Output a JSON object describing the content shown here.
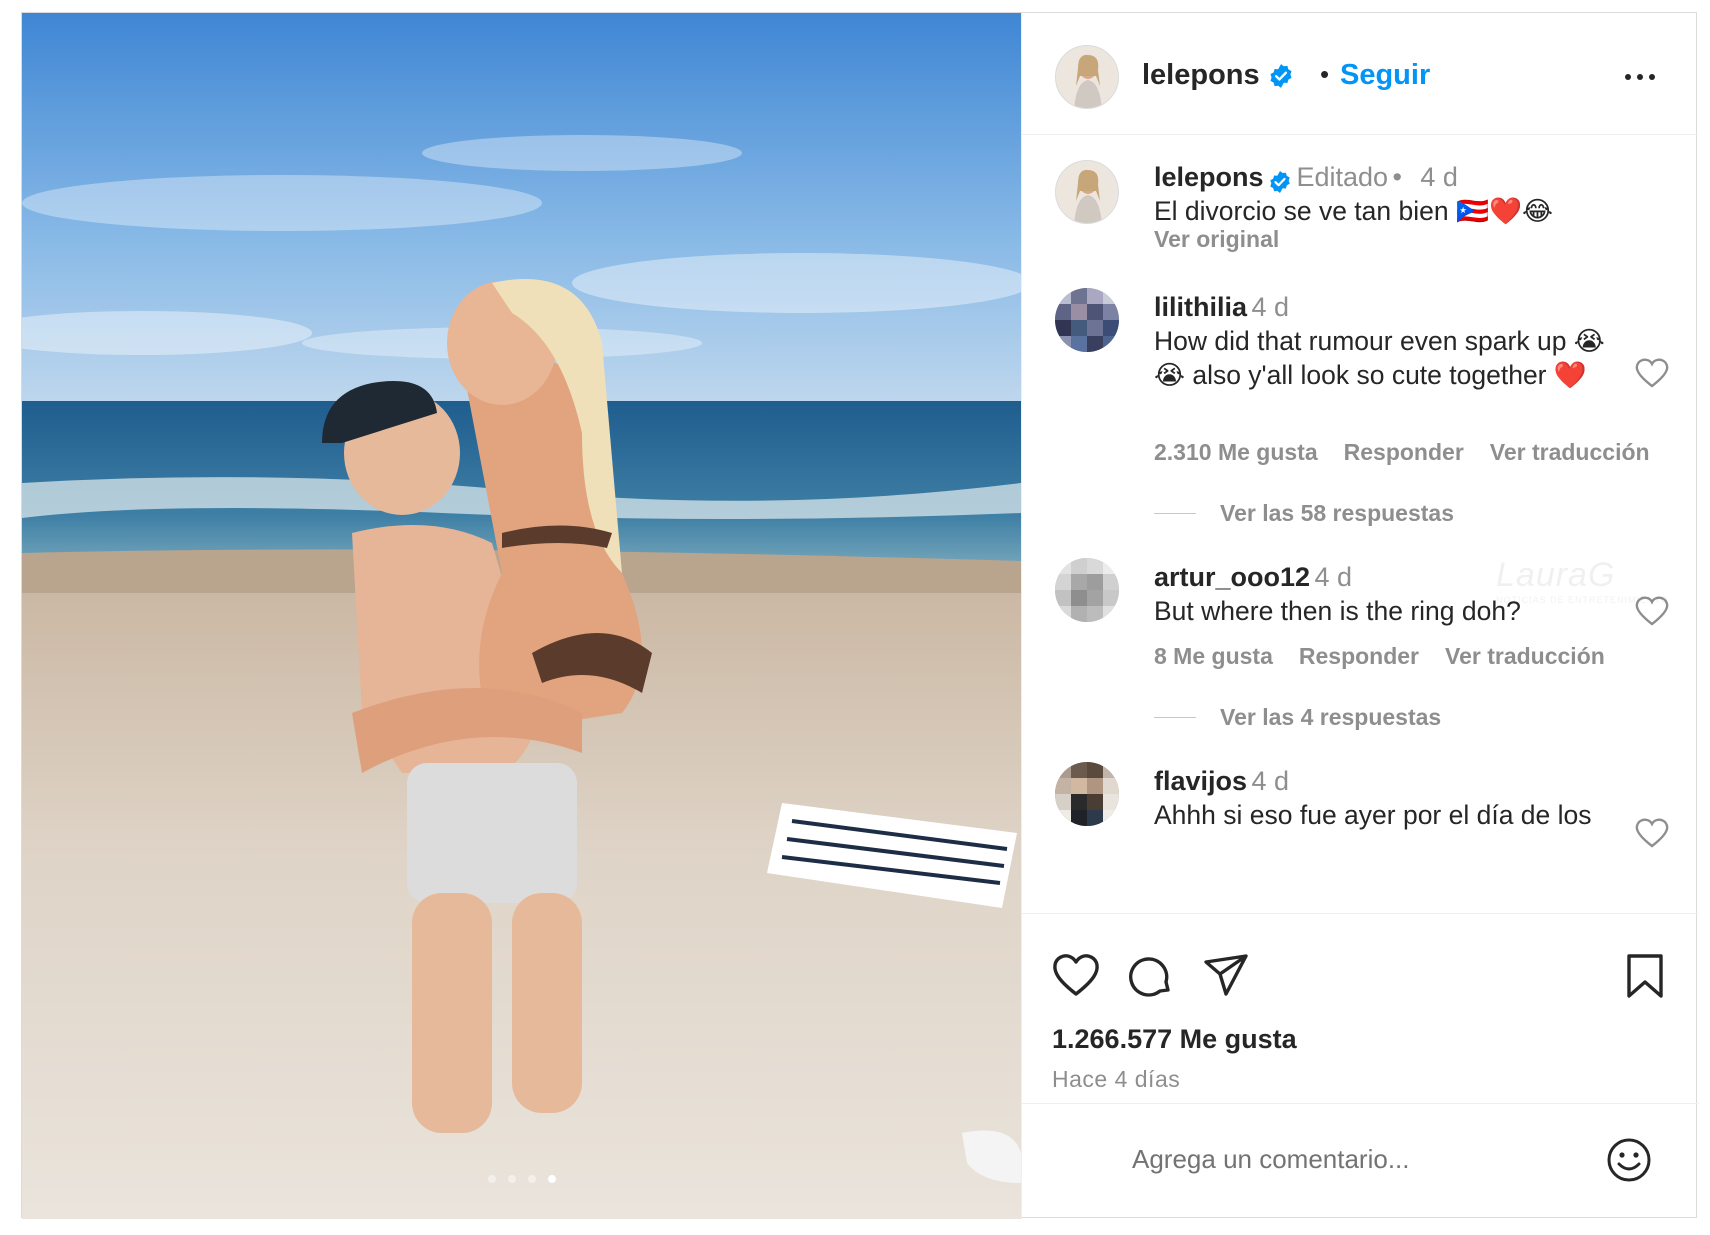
{
  "post": {
    "username": "lelepons",
    "follow_label": "Seguir",
    "separator": "•",
    "more_icon": "more-horizontal-icon",
    "caption": {
      "username": "lelepons",
      "edited": "Editado",
      "separator": "•",
      "age": "4 d",
      "text": "El divorcio se ve tan bien 🇵🇷❤️😂",
      "see_original": "Ver original"
    },
    "comments": [
      {
        "username": "lilithilia",
        "age": "4 d",
        "text": "How did that rumour even spark up 😭😭 also y'all look so cute together ❤️",
        "likes": "2.310 Me gusta",
        "reply": "Responder",
        "translate": "Ver traducción",
        "replies": "Ver las 58 respuestas"
      },
      {
        "username": "artur_ooo12",
        "age": "4 d",
        "text": "But where then is the ring doh?",
        "likes": "8 Me gusta",
        "reply": "Responder",
        "translate": "Ver traducción",
        "replies": "Ver las 4 respuestas"
      },
      {
        "username": "flavijos",
        "age": "4 d",
        "text": "Ahhh si eso fue ayer por el día de los"
      }
    ],
    "likes_count": "1.266.577 Me gusta",
    "time_ago": "Hace 4 días",
    "comment_placeholder": "Agrega un comentario...",
    "watermark": "LauraG",
    "watermark_sub": "NOTICIAS DE ENTRETENIMIENTO",
    "carousel": {
      "count": 4,
      "active_index": 3
    },
    "colors": {
      "link": "#0095f6",
      "secondary": "#8e8e8e",
      "verified": "#0095f6",
      "text": "#262626"
    }
  }
}
